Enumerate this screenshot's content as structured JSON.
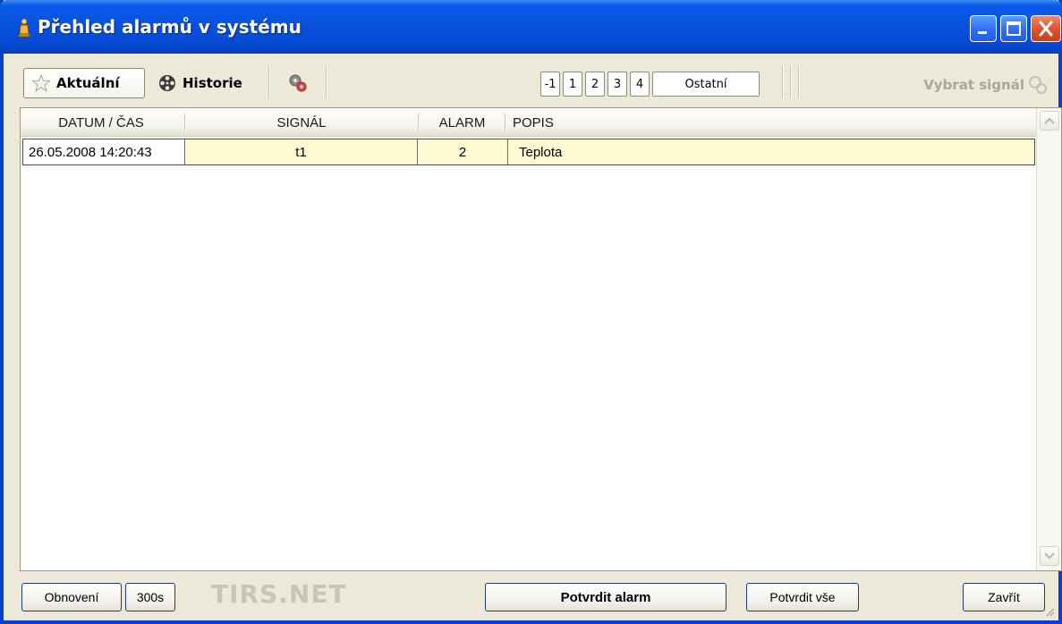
{
  "window": {
    "title": "Přehled alarmů v systému"
  },
  "toolbar": {
    "tab_current": "Aktuální",
    "tab_history": "Historie",
    "page_buttons": [
      "-1",
      "1",
      "2",
      "3",
      "4",
      "Ostatní"
    ],
    "select_signal": "Vybrat signál"
  },
  "table": {
    "columns": [
      "DATUM / ČAS",
      "SIGNÁL",
      "ALARM",
      "POPIS"
    ],
    "rows": [
      {
        "datetime": "26.05.2008 14:20:43",
        "signal": "t1",
        "alarm": "2",
        "description": "Teplota"
      }
    ]
  },
  "footer": {
    "refresh_label": "Obnovení",
    "refresh_interval": "300s",
    "brand": "TIRS.NET",
    "confirm_alarm": "Potvrdit alarm",
    "confirm_all": "Potvrdit vše",
    "close": "Zavřít"
  },
  "colors": {
    "title_blue": "#0751dc",
    "row_highlight": "#fffad2",
    "window_bg": "#ece9d8",
    "disabled_text": "#aca899"
  },
  "icons": {
    "title": "alarm-bell-icon",
    "current": "star-icon",
    "history": "film-reel-icon",
    "settings": "gears-icon",
    "select_signal": "gears-icon"
  }
}
